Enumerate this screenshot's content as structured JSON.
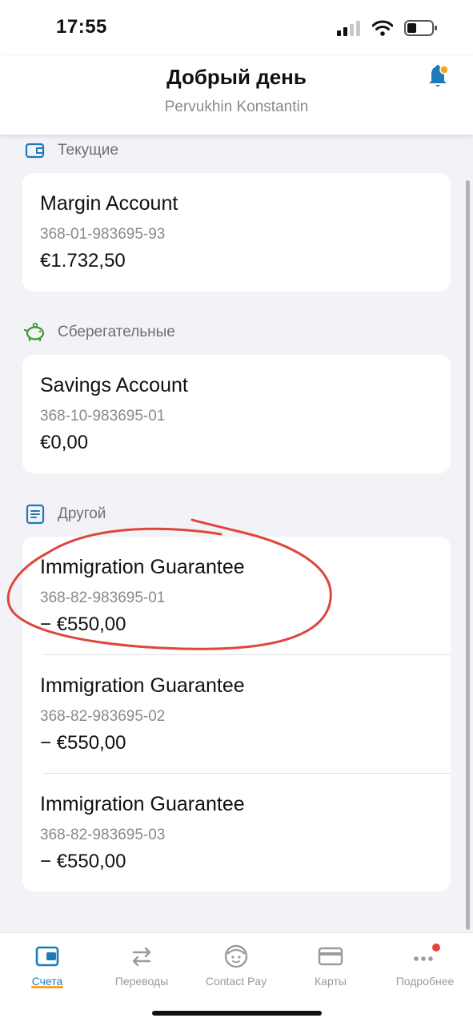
{
  "status": {
    "time": "17:55"
  },
  "header": {
    "title": "Добрый день",
    "subtitle": "Pervukhin Konstantin"
  },
  "sections": [
    {
      "label": "Текущие",
      "icon": "wallet-icon",
      "accounts": [
        {
          "name": "Margin Account",
          "number": "368-01-983695-93",
          "balance": "€1.732,50"
        }
      ]
    },
    {
      "label": "Сберегательные",
      "icon": "piggy-bank-icon",
      "accounts": [
        {
          "name": "Savings Account",
          "number": "368-10-983695-01",
          "balance": "€0,00"
        }
      ]
    },
    {
      "label": "Другой",
      "icon": "document-icon",
      "accounts": [
        {
          "name": "Immigration Guarantee",
          "number": "368-82-983695-01",
          "balance": "− €550,00"
        },
        {
          "name": "Immigration Guarantee",
          "number": "368-82-983695-02",
          "balance": "− €550,00"
        },
        {
          "name": "Immigration Guarantee",
          "number": "368-82-983695-03",
          "balance": "− €550,00"
        }
      ]
    }
  ],
  "tabs": [
    {
      "label": "Счета",
      "icon": "accounts-icon",
      "active": true
    },
    {
      "label": "Переводы",
      "icon": "transfer-arrows-icon"
    },
    {
      "label": "Contact Pay",
      "icon": "contact-pay-icon"
    },
    {
      "label": "Карты",
      "icon": "card-icon"
    },
    {
      "label": "Подробнее",
      "icon": "more-dots-icon"
    }
  ],
  "colors": {
    "accent": "#1e7ab8",
    "tab_underline": "#f5a623",
    "notification_dot": "#e8443a",
    "annotation_circle": "#e0453a",
    "piggy_icon": "#3a9a2a"
  }
}
